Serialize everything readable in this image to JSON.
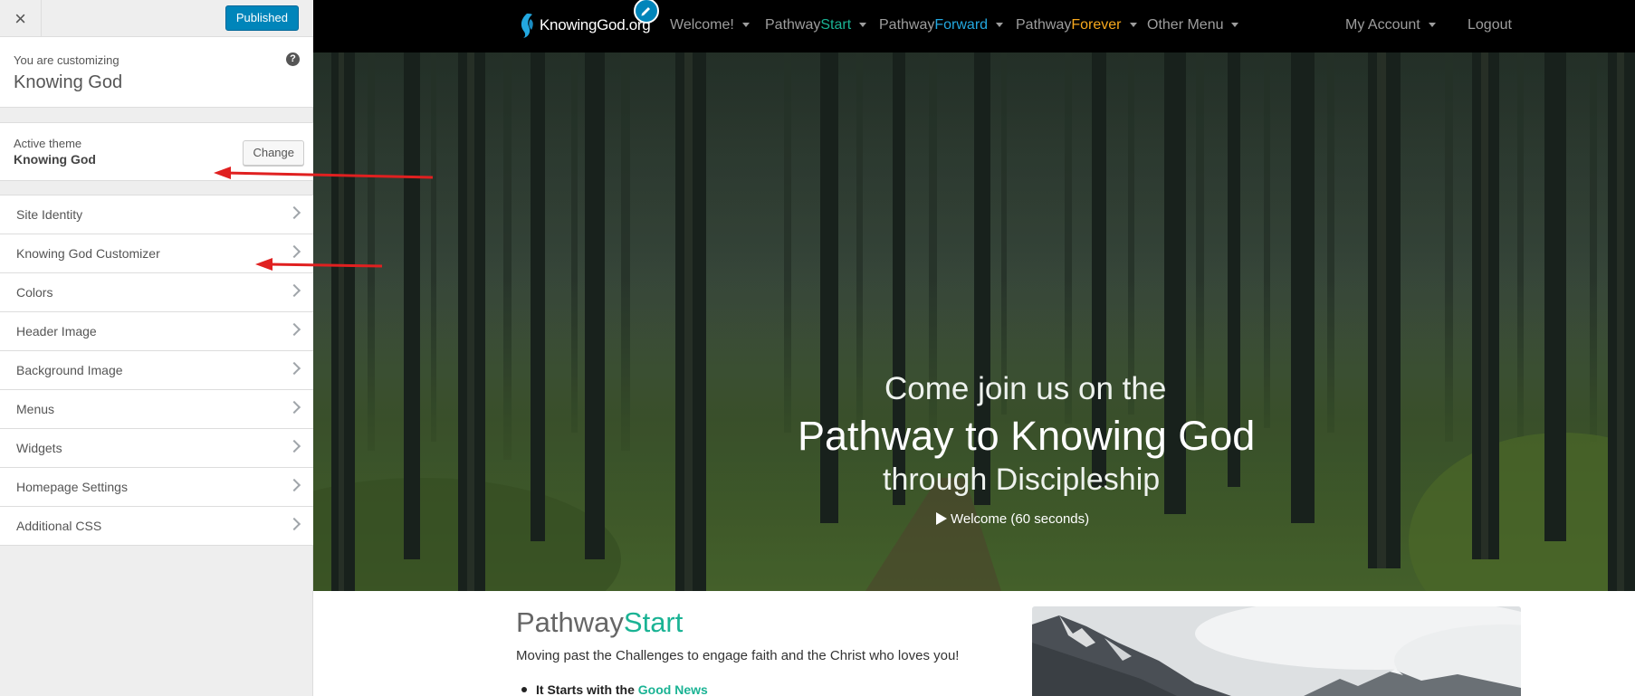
{
  "customizer": {
    "close_label": "×",
    "publish_label": "Published",
    "info": {
      "small": "You are customizing",
      "site_name": "Knowing God"
    },
    "theme": {
      "small": "Active theme",
      "name": "Knowing God",
      "change_label": "Change"
    },
    "sections": [
      {
        "label": "Site Identity"
      },
      {
        "label": "Knowing God Customizer"
      },
      {
        "label": "Colors"
      },
      {
        "label": "Header Image"
      },
      {
        "label": "Background Image"
      },
      {
        "label": "Menus"
      },
      {
        "label": "Widgets"
      },
      {
        "label": "Homepage Settings"
      },
      {
        "label": "Additional CSS"
      }
    ]
  },
  "site": {
    "logo_text": "KnowingGod.org",
    "nav": {
      "welcome": "Welcome!",
      "pathway_start": {
        "prefix": "Pathway",
        "accent": "Start"
      },
      "pathway_forward": {
        "prefix": "Pathway",
        "accent": "Forward"
      },
      "pathway_forever": {
        "prefix": "Pathway",
        "accent": "Forever"
      },
      "other": "Other Menu",
      "my_account": "My Account",
      "logout": "Logout"
    },
    "hero": {
      "line1": "Come join us on the",
      "line2": "Pathway to Knowing God",
      "line3": "through Discipleship",
      "video_link": "Welcome (60 seconds)"
    },
    "section": {
      "title_prefix": "Pathway",
      "title_accent": "Start",
      "description": "Moving past the Challenges to engage faith and the Christ who loves you!",
      "bullet_prefix": "It Starts with the",
      "bullet_accent": "Good News"
    }
  },
  "colors": {
    "publish_blue": "#0085ba",
    "start_green": "#1ab394",
    "forward_blue": "#23a8e0",
    "forever_orange": "#f7a81d",
    "annotation_red": "#e02020"
  }
}
